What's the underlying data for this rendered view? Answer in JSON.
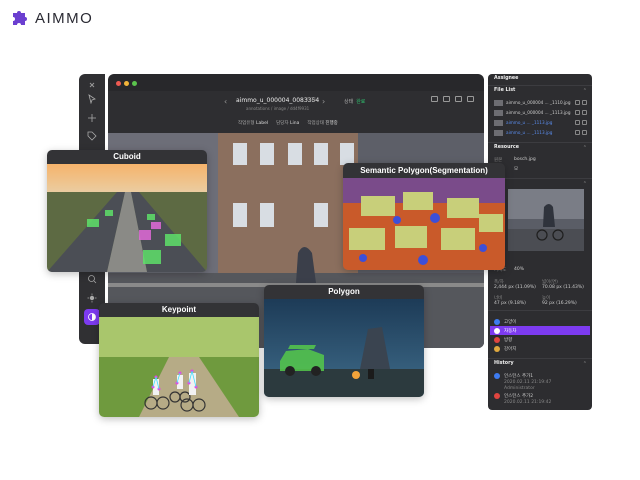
{
  "brand": {
    "name": "AIMMO"
  },
  "window": {
    "file_name": "aimmo_u_000004_0083354",
    "file_count": "1/36",
    "file_path": "annotations / image / dd4f9931",
    "status_label": "상태",
    "status_value": "완료",
    "work_type_label": "작업유형",
    "work_type_value": "Label",
    "worker_label": "담당자",
    "worker_value": "Lina",
    "progress_label": "작업상태",
    "progress_value": "진행중"
  },
  "cards": {
    "cuboid": "Cuboid",
    "segmentation": "Semantic Polygon(Segmentation)",
    "keypoint": "Keypoint",
    "polygon": "Polygon"
  },
  "panel": {
    "assignee_title": "Assignee",
    "file_list_title": "File List",
    "files": [
      {
        "name": "aimmo_u_000004 ... _1110.jpg",
        "color": "#cccccc"
      },
      {
        "name": "aimmo_u_000004 ... _1113.jpg",
        "color": "#cccccc"
      },
      {
        "name": "aimmo_u ... _1113.jpg",
        "color": "#5a8dee"
      },
      {
        "name": "aimmo_u ... _1113.jpg",
        "color": "#5a8dee"
      }
    ],
    "resource_title": "Resource",
    "resource_rows": [
      {
        "label": "원본",
        "value": "bosch.jpg"
      },
      {
        "label": "",
        "value": "모"
      }
    ],
    "info_title": "o",
    "zoom_label": "가시도",
    "zoom_value": "40%",
    "stats": [
      {
        "label": "폭/자",
        "value": "2,444 px (11.09%)"
      },
      {
        "label": "넓이(면)",
        "value": "70.08 px (11.43%)"
      },
      {
        "label": "너비",
        "value": "47 px (9.18%)"
      },
      {
        "label": "높이",
        "value": "92 px (16.29%)"
      }
    ],
    "classes": [
      {
        "name": "고양이",
        "color": "#3d7bf0"
      },
      {
        "name": "자동차",
        "color": "#7d3bf0"
      },
      {
        "name": "방향",
        "color": "#e0453f"
      },
      {
        "name": "강아지",
        "color": "#e0a93f"
      }
    ],
    "history_title": "History",
    "history": [
      {
        "title": "인스턴스 추가1",
        "time": "2020.02.11 21:19:47",
        "who": "Administrator",
        "color": "#3d7bf0"
      },
      {
        "title": "인스턴스 추가2",
        "time": "2020.02.11 21:19:42",
        "who": "",
        "color": "#e0453f"
      }
    ]
  }
}
